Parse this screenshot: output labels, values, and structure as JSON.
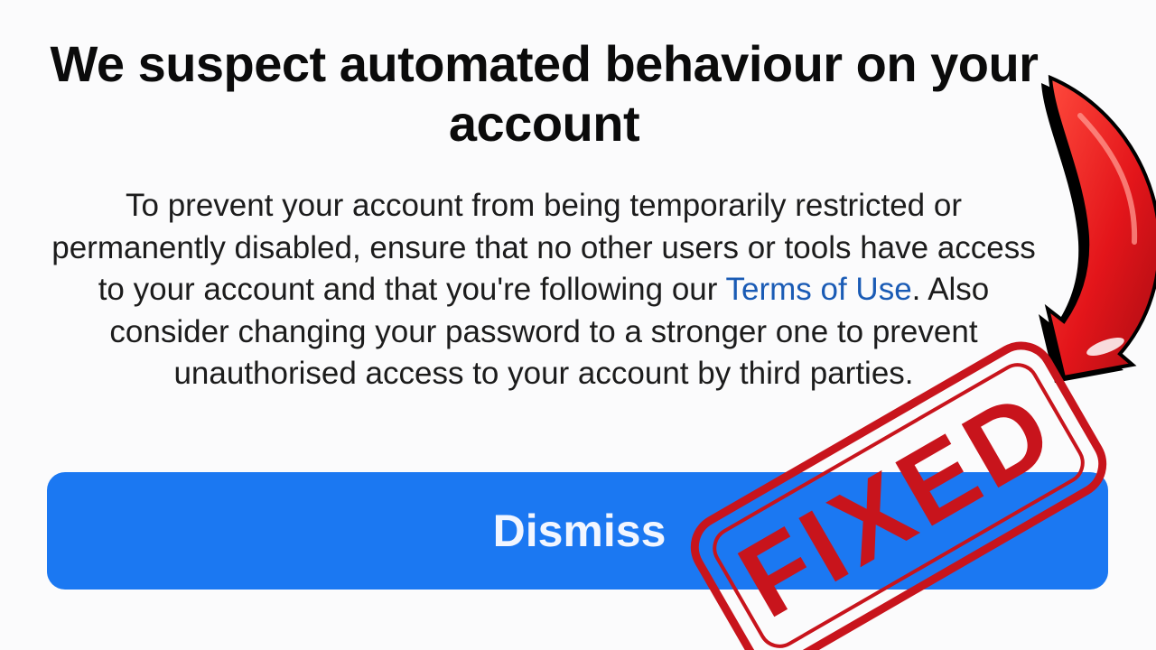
{
  "dialog": {
    "title": "We suspect automated behaviour on your account",
    "body_before_link": "To prevent your account from being temporarily restricted or permanently disabled, ensure that no other users or tools have access to your account and that you're following our ",
    "link_text": "Terms of Use",
    "body_after_link": ". Also consider changing your password to a stronger one to prevent unauthorised access to your account by third parties.",
    "dismiss_label": "Dismiss"
  },
  "overlay": {
    "arrow": {
      "icon": "curved-arrow-icon",
      "color": "#e3151a"
    },
    "stamp": {
      "text": "FIXED",
      "color": "#c8141c"
    }
  },
  "colors": {
    "background": "#fbfbfc",
    "button": "#1b78f2",
    "link": "#1a5bb5"
  }
}
